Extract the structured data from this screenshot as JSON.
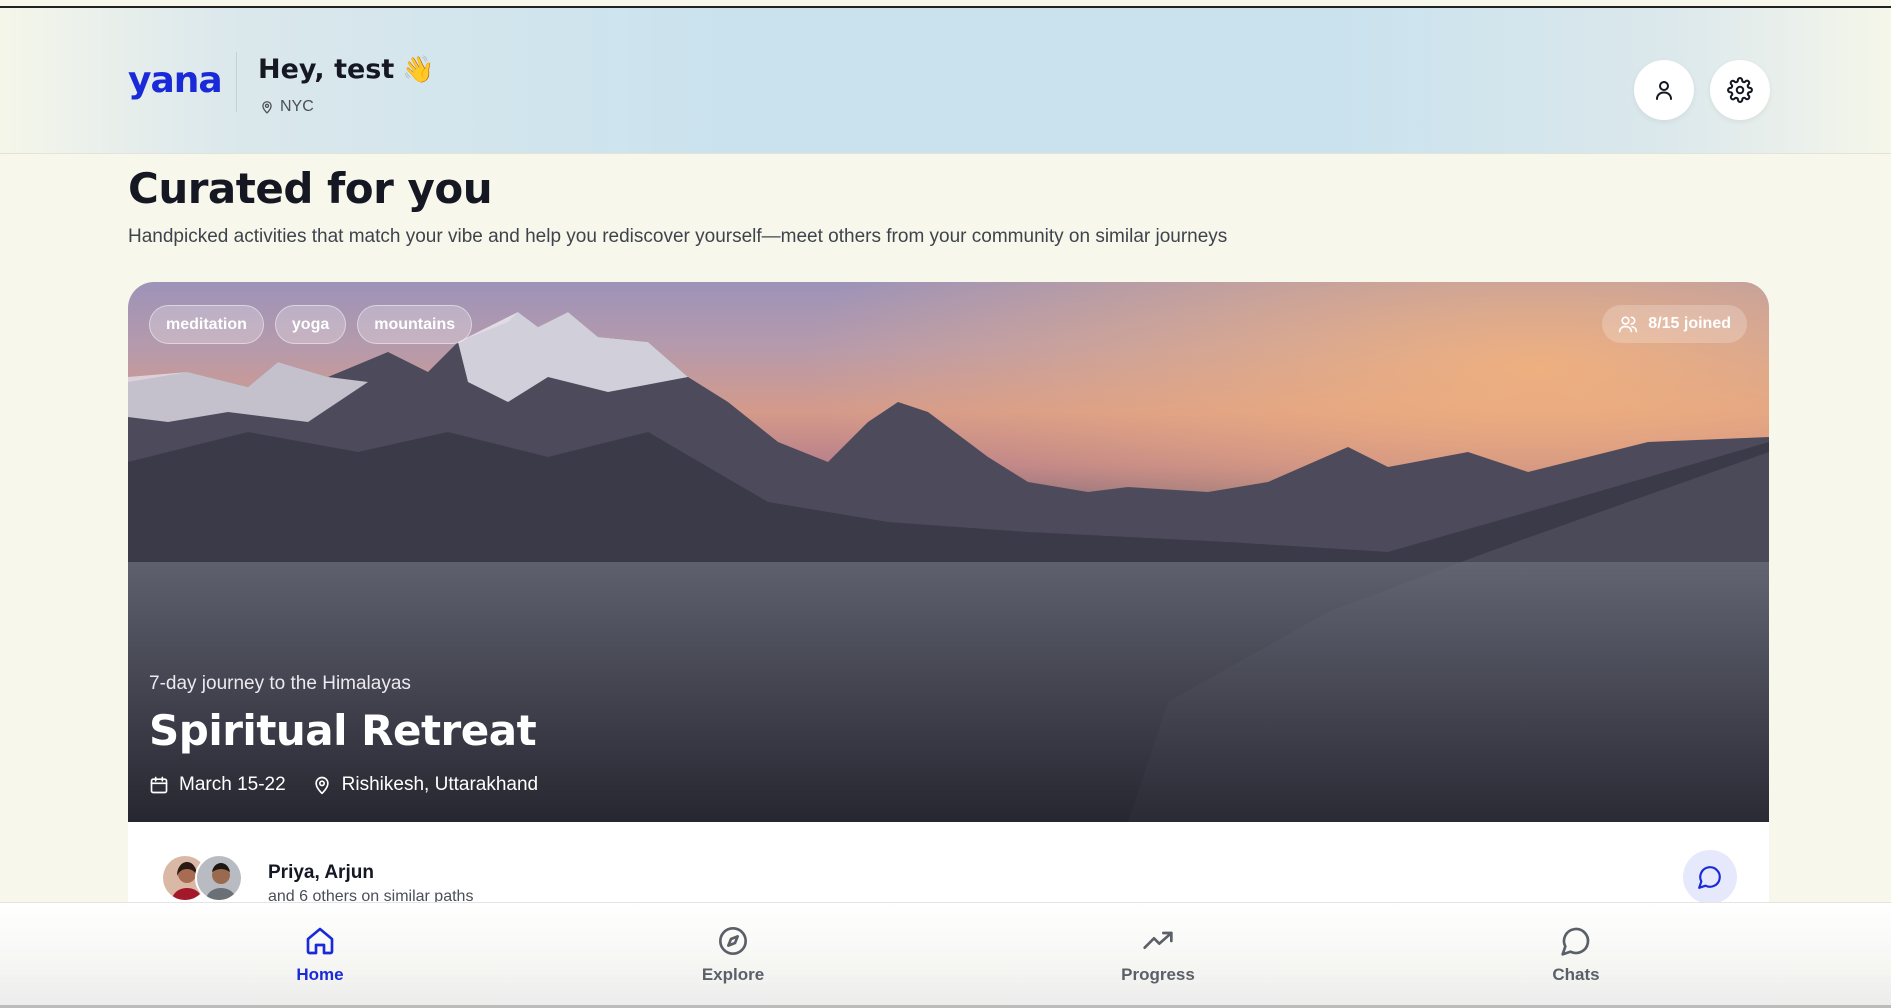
{
  "header": {
    "logo": "yana",
    "greeting": "Hey, test",
    "wave_emoji": "👋",
    "location": "NYC",
    "profile_icon": "user-icon",
    "settings_icon": "gear-icon"
  },
  "main": {
    "title": "Curated for you",
    "subtitle": "Handpicked activities that match your vibe and help you rediscover yourself—meet others from your community on similar journeys"
  },
  "card": {
    "tags": [
      "meditation",
      "yoga",
      "mountains"
    ],
    "joined": "8/15 joined",
    "subtitle": "7-day journey to the Himalayas",
    "title": "Spiritual Retreat",
    "date": "March 15-22",
    "location": "Rishikesh, Uttarakhand",
    "peers_names": "Priya, Arjun",
    "peers_sub": "and 6 others on similar paths"
  },
  "nav": {
    "items": [
      {
        "label": "Home",
        "icon": "home-icon",
        "active": true
      },
      {
        "label": "Explore",
        "icon": "compass-icon",
        "active": false
      },
      {
        "label": "Progress",
        "icon": "trending-up-icon",
        "active": false
      },
      {
        "label": "Chats",
        "icon": "chat-bubble-icon",
        "active": false
      }
    ]
  },
  "colors": {
    "brand": "#1a2ad8",
    "background": "#f7f7ec",
    "text_dark": "#151823"
  }
}
